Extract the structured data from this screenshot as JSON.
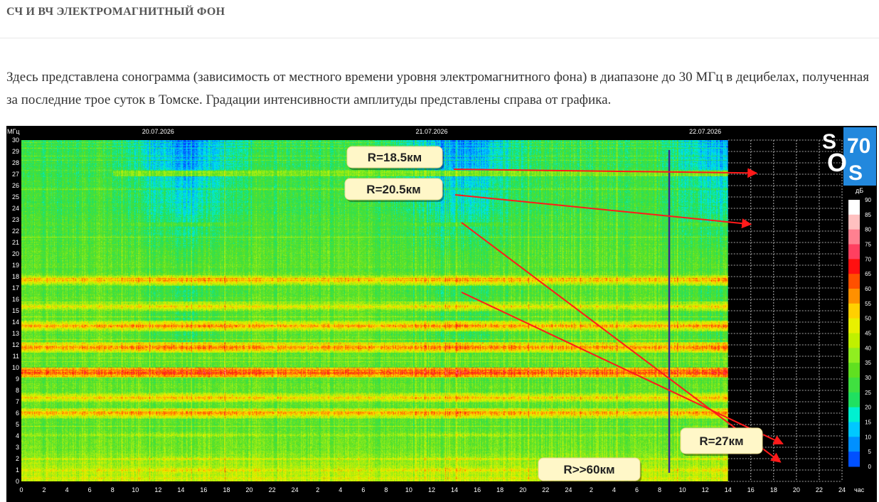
{
  "header": {
    "title": "СЧ И ВЧ ЭЛЕКТРОМАГНИТНЫЙ ФОН"
  },
  "description": "Здесь представлена сонограмма (зависимость от местного времени уровня электромагнитного фона) в диапазоне до 30 МГц в децибелах, полученная за последние трое суток в Томске. Градации интенсивности амплитуды представлены справа от графика.",
  "chart_data": {
    "type": "heatmap",
    "ylabel": "МГц",
    "xlabel": "час",
    "ylim": [
      0,
      30
    ],
    "y_ticks": [
      0,
      1,
      2,
      3,
      4,
      5,
      6,
      7,
      8,
      9,
      10,
      11,
      12,
      13,
      14,
      15,
      16,
      17,
      18,
      19,
      20,
      21,
      22,
      23,
      24,
      25,
      26,
      27,
      28,
      29,
      30
    ],
    "x_ticks": [
      "0",
      "2",
      "4",
      "6",
      "8",
      "10",
      "12",
      "14",
      "16",
      "18",
      "20",
      "22",
      "24",
      "2",
      "4",
      "6",
      "8",
      "10",
      "12",
      "14",
      "16",
      "18",
      "20",
      "22",
      "24",
      "2",
      "4",
      "6",
      "8",
      "10",
      "12",
      "14",
      "16",
      "18",
      "20",
      "22",
      "24"
    ],
    "dates": [
      "20.07.2026",
      "21.07.2026",
      "22.07.2026"
    ],
    "data_end_hour": 62,
    "colorbar": {
      "unit": "дБ",
      "ticks": [
        0,
        5,
        10,
        15,
        20,
        25,
        30,
        35,
        40,
        45,
        50,
        55,
        60,
        65,
        70,
        75,
        80,
        85,
        90
      ],
      "colors": [
        "#0000ff",
        "#0050ff",
        "#0090ff",
        "#00c8ff",
        "#00f0d0",
        "#20e060",
        "#40e040",
        "#60e020",
        "#90ee20",
        "#c0f000",
        "#e8f000",
        "#ffd000",
        "#ff9000",
        "#ff5000",
        "#ff1010",
        "#ff4060",
        "#ff8090",
        "#ffc0c0",
        "#ffffff"
      ]
    },
    "bands_mhz": [
      {
        "f": 17.7,
        "level": 60
      },
      {
        "f": 15.4,
        "level": 55
      },
      {
        "f": 13.7,
        "level": 62
      },
      {
        "f": 11.8,
        "level": 65
      },
      {
        "f": 9.6,
        "level": 70
      },
      {
        "f": 7.4,
        "level": 58
      },
      {
        "f": 6.0,
        "level": 62
      },
      {
        "f": 4.1,
        "level": 45
      },
      {
        "f": 2.0,
        "level": 50
      },
      {
        "f": 1.0,
        "level": 55
      }
    ],
    "annotations": [
      {
        "label": "R=18.5км",
        "target_hour": 64.5,
        "target_mhz": 27.1
      },
      {
        "label": "R=20.5км",
        "target_hour": 64.0,
        "target_mhz": 22.6
      },
      {
        "label": "R=27км",
        "target_hour": 66.8,
        "target_mhz": 3.3
      },
      {
        "label": "R>>60км",
        "target_hour": 66.6,
        "target_mhz": 1.7
      }
    ]
  },
  "logo": {
    "text": "SOS70",
    "colors": [
      "#2288dd",
      "#ffffff"
    ]
  }
}
